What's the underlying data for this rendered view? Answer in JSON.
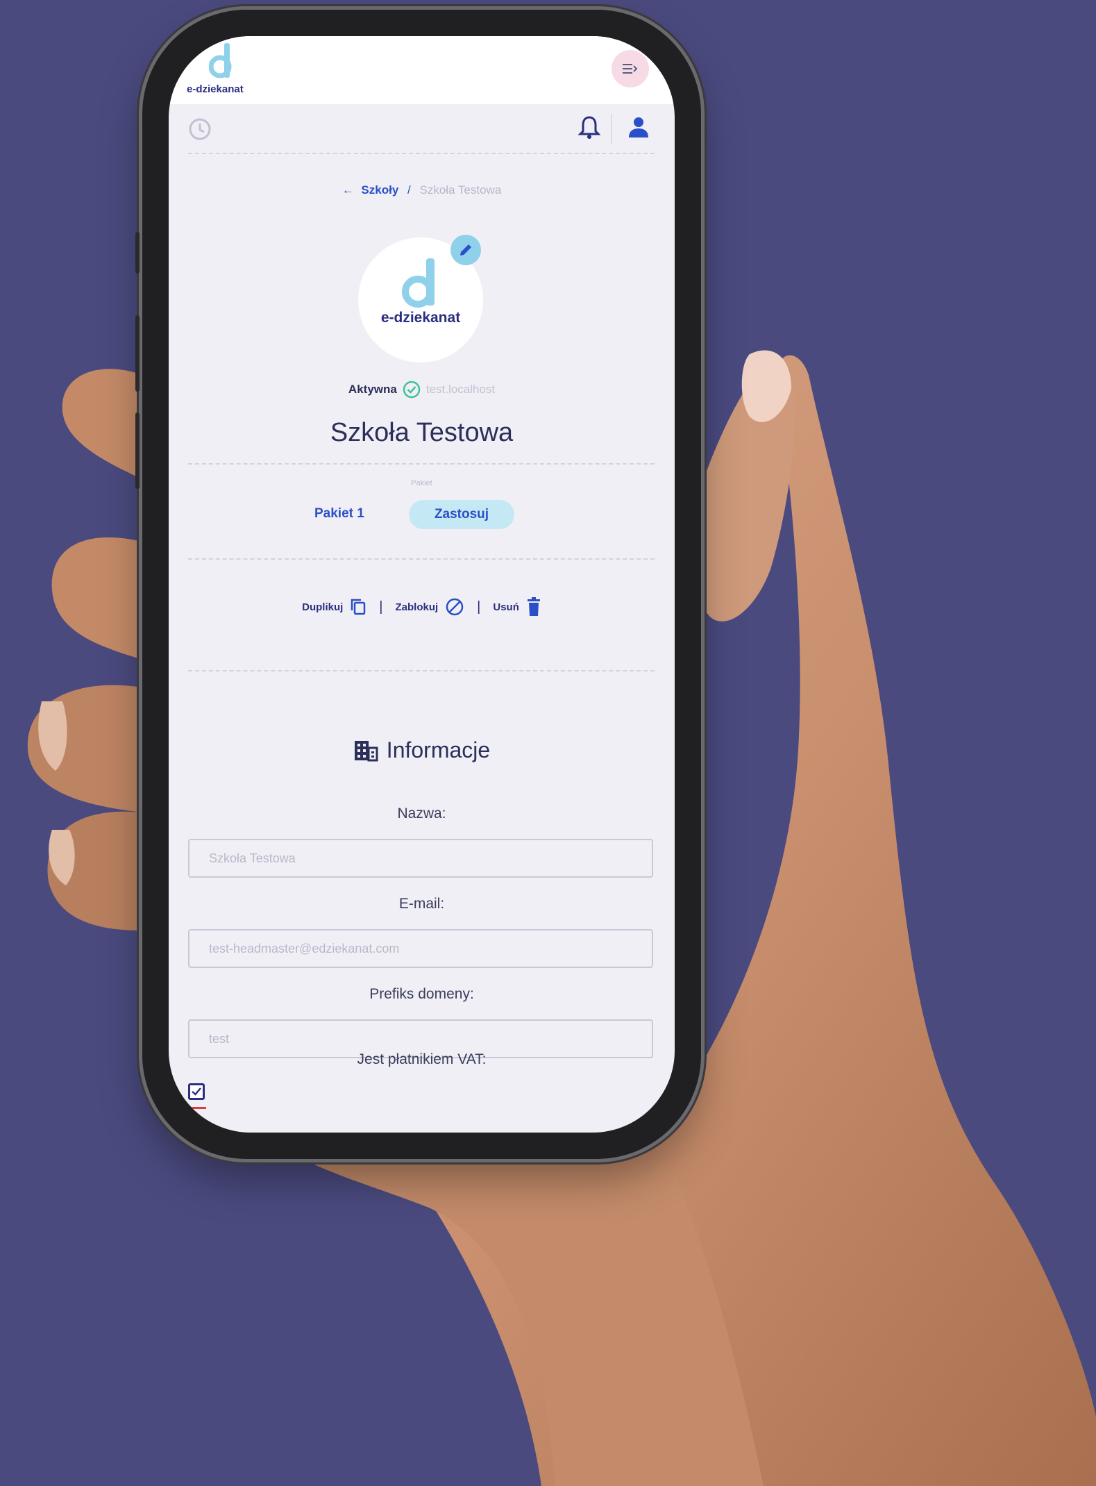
{
  "app": {
    "logo_text": "e-dziekanat"
  },
  "breadcrumb": {
    "parent": "Szkoły",
    "separator": "/",
    "current": "Szkoła Testowa"
  },
  "school": {
    "avatar_logo_text": "e-dziekanat",
    "status": "Aktywna",
    "domain": "test.localhost",
    "name": "Szkoła Testowa"
  },
  "package": {
    "caption": "Pakiet",
    "value": "Pakiet 1",
    "apply_label": "Zastosuj"
  },
  "actions": {
    "duplicate": "Duplikuj",
    "block": "Zablokuj",
    "delete": "Usuń",
    "separator": "|"
  },
  "info": {
    "title": "Informacje",
    "fields": [
      {
        "label": "Nazwa:",
        "value": "Szkoła Testowa"
      },
      {
        "label": "E-mail:",
        "value": "test-headmaster@edziekanat.com"
      },
      {
        "label": "Prefiks domeny:",
        "value": "test"
      }
    ],
    "vat_label": "Jest płatnikiem VAT:",
    "vat_checked": true
  },
  "colors": {
    "background": "#4a4a7f",
    "accent": "#2a4fc8",
    "brand_dark": "#2b2f80",
    "logo_light": "#8fd0ea",
    "apply_bg": "#c4e8f4",
    "success": "#3fc29a"
  },
  "icons": [
    "history-icon",
    "bell-icon",
    "user-icon",
    "menu-icon",
    "pencil-icon",
    "check-circle-icon",
    "copy-icon",
    "block-icon",
    "trash-icon",
    "building-icon",
    "back-arrow-icon"
  ]
}
